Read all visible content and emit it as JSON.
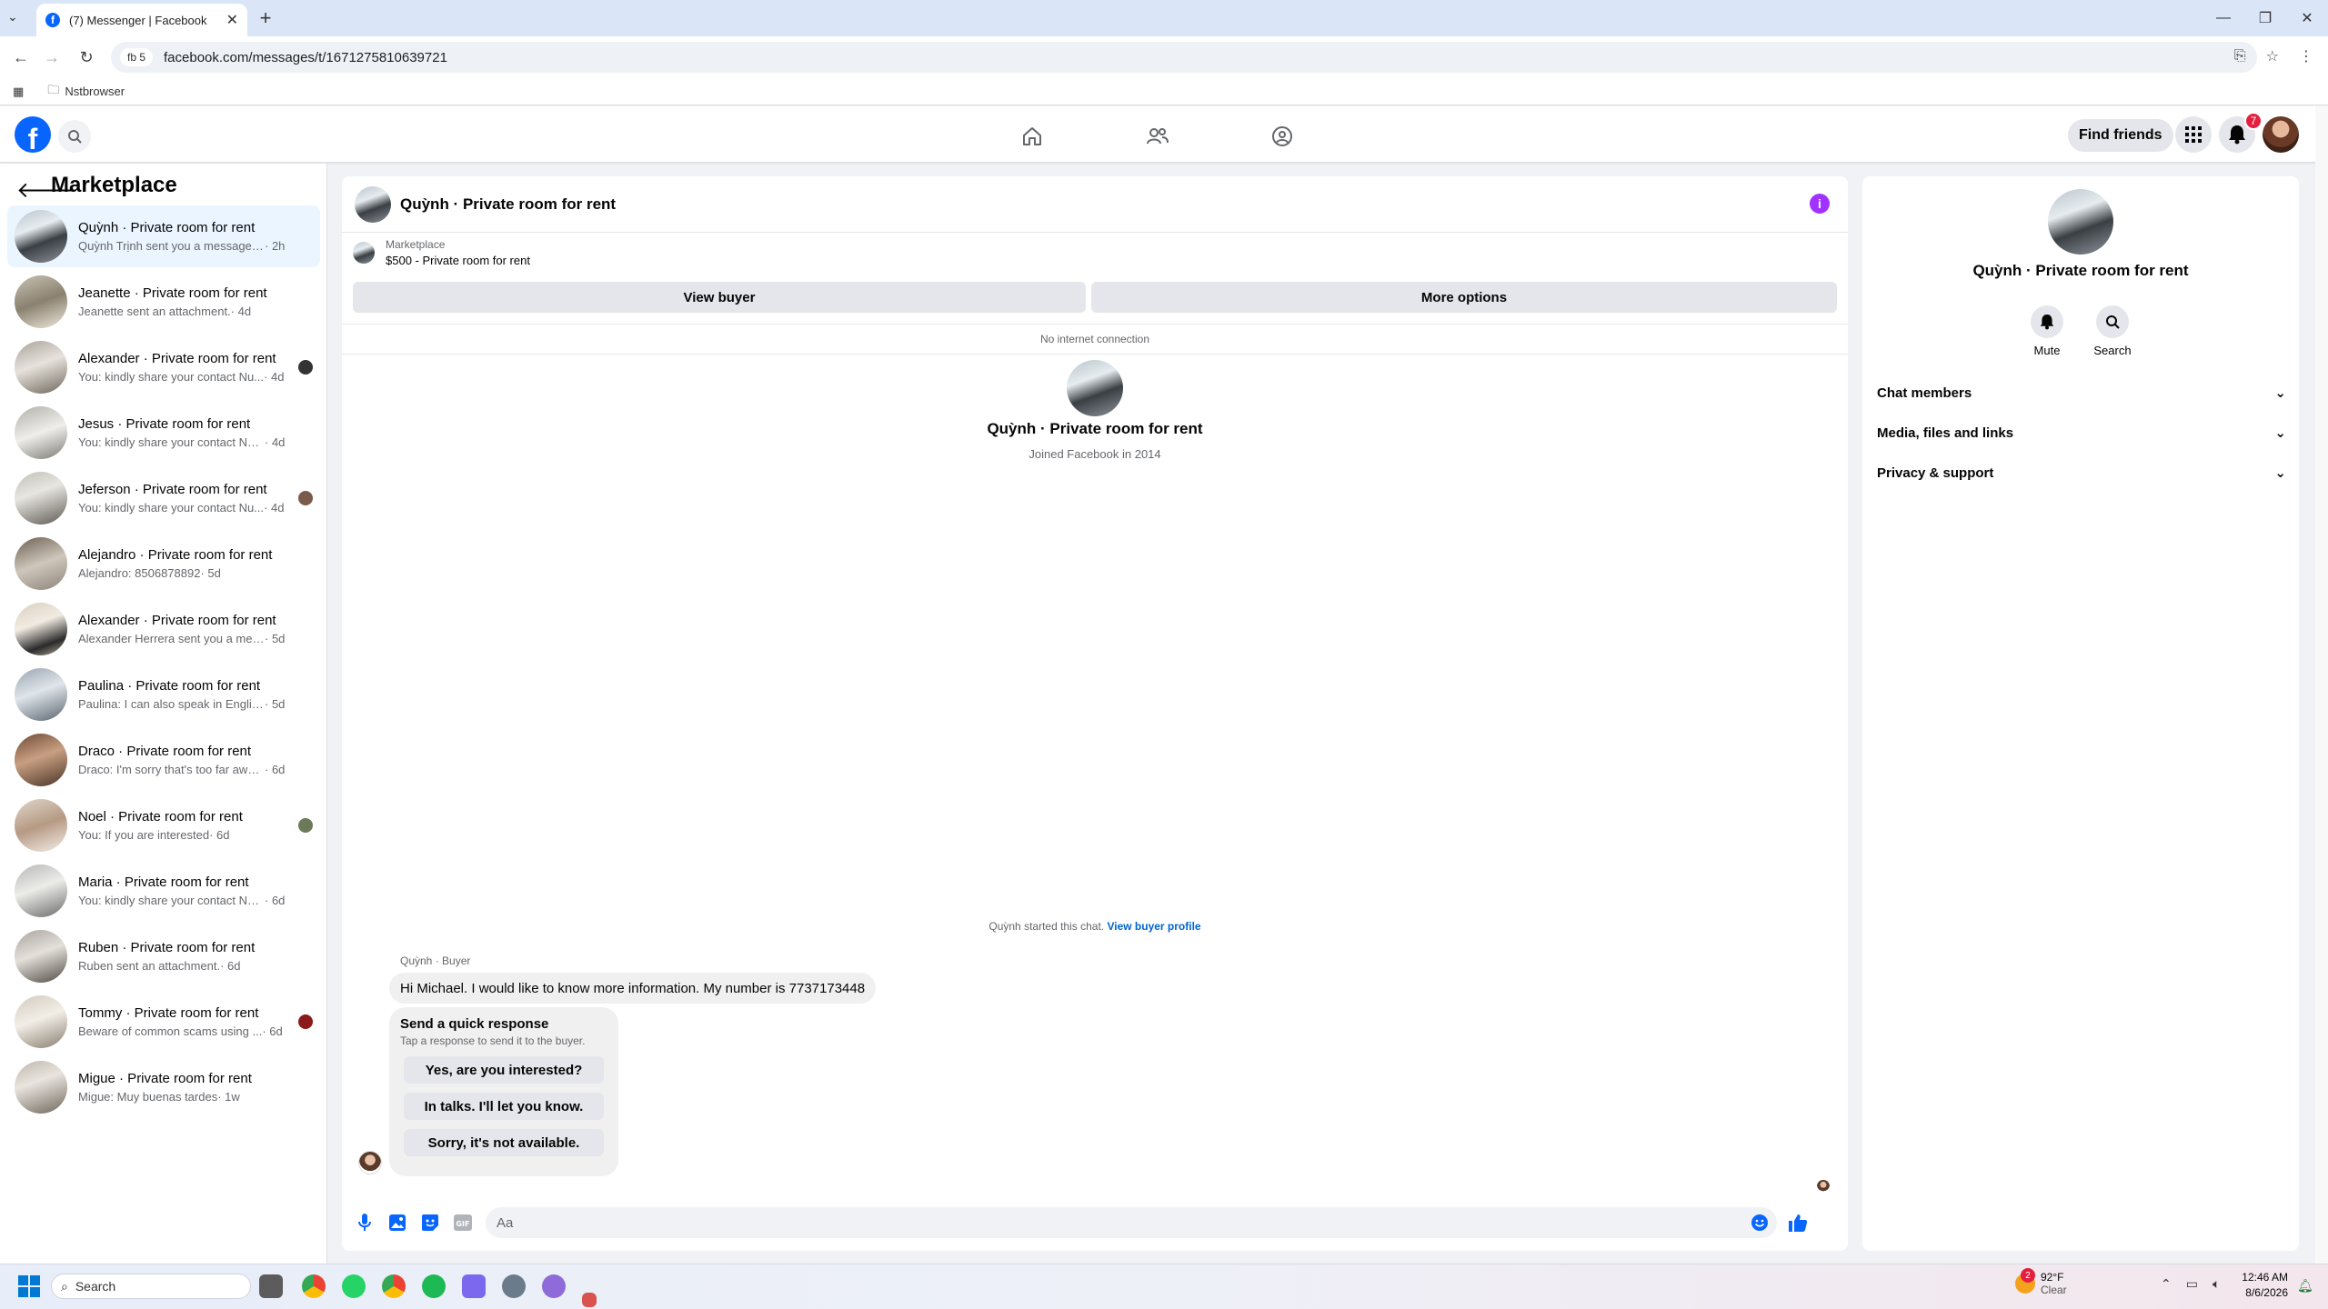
{
  "browser": {
    "tab_title": "(7) Messenger | Facebook",
    "site_chip": "fb 5",
    "url": "facebook.com/messages/t/1671275810639721",
    "bookmark": "Nstbrowser"
  },
  "header": {
    "find_friends": "Find friends",
    "notif_count": "7"
  },
  "sidebar": {
    "title": "Marketplace",
    "conversations": [
      {
        "name": "Quỳnh · Private room for rent",
        "snippet": "Quỳnh Trịnh sent you a message ab...",
        "time": "2h"
      },
      {
        "name": "Jeanette · Private room for rent",
        "snippet": "Jeanette sent an attachment.",
        "time": "4d"
      },
      {
        "name": "Alexander · Private room for rent",
        "snippet": "You: kindly share your contact Nu...",
        "time": "4d"
      },
      {
        "name": "Jesus · Private room for rent",
        "snippet": "You: kindly share your contact Numb...",
        "time": "4d"
      },
      {
        "name": "Jeferson · Private room for rent",
        "snippet": "You: kindly share your contact Nu...",
        "time": "4d"
      },
      {
        "name": "Alejandro · Private room for rent",
        "snippet": "Alejandro: 8506878892",
        "time": "5d"
      },
      {
        "name": "Alexander · Private room for rent",
        "snippet": "Alexander Herrera sent you a messa...",
        "time": "5d"
      },
      {
        "name": "Paulina · Private room for rent",
        "snippet": "Paulina: I can also speak in English, ...",
        "time": "5d"
      },
      {
        "name": "Draco · Private room for rent",
        "snippet": "Draco: I'm sorry that's too far away f...",
        "time": "6d"
      },
      {
        "name": "Noel · Private room for rent",
        "snippet": "You: If you are interested",
        "time": "6d"
      },
      {
        "name": "Maria · Private room for rent",
        "snippet": "You: kindly share your contact Numb...",
        "time": "6d"
      },
      {
        "name": "Ruben · Private room for rent",
        "snippet": "Ruben sent an attachment.",
        "time": "6d"
      },
      {
        "name": "Tommy · Private room for rent",
        "snippet": "Beware of common scams using ...",
        "time": "6d"
      },
      {
        "name": "Migue · Private room for rent",
        "snippet": "Migue: Muy buenas tardes",
        "time": "1w"
      }
    ]
  },
  "chat": {
    "title": "Quỳnh · Private room for rent",
    "listing_source": "Marketplace",
    "listing_title": "$500 - Private room for rent",
    "view_buyer": "View buyer",
    "more_options": "More options",
    "no_internet": "No internet connection",
    "hero_name": "Quỳnh · Private room for rent",
    "joined": "Joined Facebook in 2014",
    "started_text": "Quỳnh started this chat.",
    "view_profile": "View buyer profile",
    "sender_label": "Quỳnh · Buyer",
    "message": "Hi Michael. I would like to know more information. My number is 7737173448",
    "quick_title": "Send a quick response",
    "quick_sub": "Tap a response to send it to the buyer.",
    "quick_replies": [
      "Yes, are you interested?",
      "In talks. I'll let you know.",
      "Sorry, it's not available."
    ],
    "input_placeholder": "Aa"
  },
  "right_panel": {
    "name": "Quỳnh · Private room for rent",
    "mute": "Mute",
    "search": "Search",
    "sections": [
      "Chat members",
      "Media, files and links",
      "Privacy & support"
    ]
  },
  "taskbar": {
    "search": "Search",
    "weather_temp": "92°F",
    "weather_desc": "Clear",
    "weather_badge": "2",
    "time": "12:46 AM",
    "date": "8/6/2026"
  },
  "colors": {
    "fb_blue": "#0866ff",
    "link_blue": "#0064d1",
    "info_purple": "#a033ff",
    "badge_red": "#e41e3f"
  }
}
